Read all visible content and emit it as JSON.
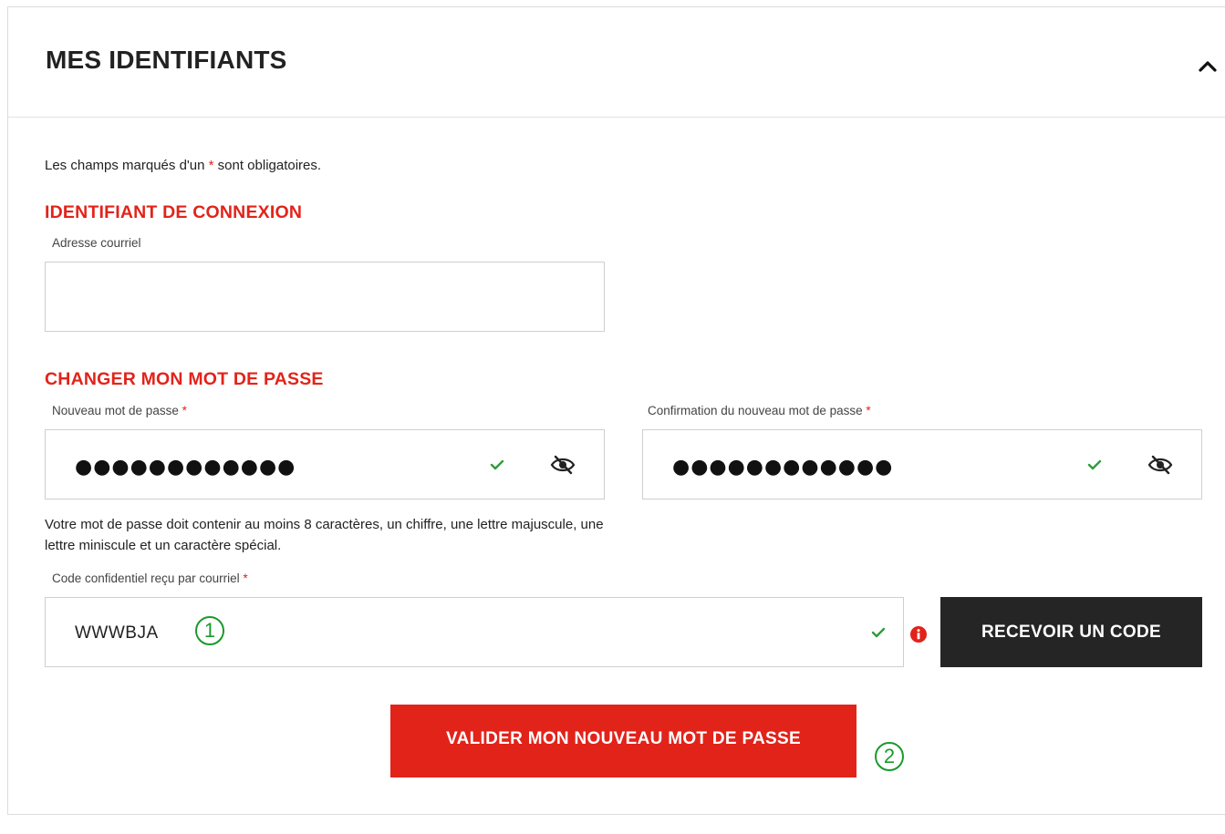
{
  "card": {
    "title": "MES IDENTIFIANTS",
    "collapse_icon": "chevron-up-icon"
  },
  "note": {
    "before": "Les champs marqués d'un ",
    "star": "*",
    "after": " sont obligatoires."
  },
  "login_section": {
    "title": "IDENTIFIANT DE CONNEXION",
    "email": {
      "label": "Adresse courriel",
      "value": "",
      "placeholder": ""
    }
  },
  "password_section": {
    "title": "CHANGER MON MOT DE PASSE",
    "new_password": {
      "label": "Nouveau mot de passe",
      "required_star": "*",
      "masked_value": "●●●●●●●●●●●●",
      "valid_icon": "check-icon",
      "toggle_icon": "eye-slash-icon"
    },
    "confirm_password": {
      "label": "Confirmation du nouveau mot de passe",
      "required_star": "*",
      "masked_value": "●●●●●●●●●●●●",
      "valid_icon": "check-icon",
      "toggle_icon": "eye-slash-icon"
    },
    "hint": "Votre mot de passe doit contenir au moins 8 caractères, un chiffre, une lettre majuscule, une lettre miniscule et un caractère spécial.",
    "code": {
      "label": "Code confidentiel reçu par courriel",
      "required_star": "*",
      "value": "WWWBJA",
      "step_marker": "①",
      "valid_icon": "check-icon",
      "info_icon": "info-icon"
    },
    "receive_code_button": "RECEVOIR UN CODE",
    "submit_button": "VALIDER MON NOUVEAU MOT DE PASSE",
    "submit_step_marker": "②"
  },
  "colors": {
    "accent_red": "#e2231a",
    "dark_button": "#252525",
    "success_green": "#2e9d3a",
    "marker_green": "#1a9a2a"
  }
}
